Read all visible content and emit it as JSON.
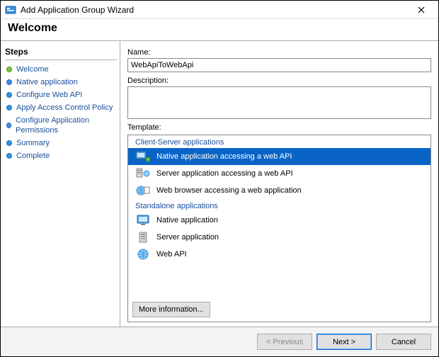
{
  "window": {
    "title": "Add Application Group Wizard"
  },
  "page_header": "Welcome",
  "sidebar": {
    "title": "Steps",
    "items": [
      {
        "label": "Welcome",
        "state": "current"
      },
      {
        "label": "Native application",
        "state": "pending"
      },
      {
        "label": "Configure Web API",
        "state": "pending"
      },
      {
        "label": "Apply Access Control Policy",
        "state": "pending"
      },
      {
        "label": "Configure Application Permissions",
        "state": "pending"
      },
      {
        "label": "Summary",
        "state": "pending"
      },
      {
        "label": "Complete",
        "state": "pending"
      }
    ]
  },
  "main": {
    "name_label": "Name:",
    "name_value": "WebApiToWebApi",
    "description_label": "Description:",
    "description_value": "",
    "template_label": "Template:",
    "groups": {
      "client_server": "Client-Server applications",
      "standalone": "Standalone applications"
    },
    "templates": {
      "native_access_api": "Native application accessing a web API",
      "server_access_api": "Server application accessing a web API",
      "browser_access_app": "Web browser accessing a web application",
      "native_app": "Native application",
      "server_app": "Server application",
      "web_api": "Web API"
    },
    "more_info": "More information..."
  },
  "footer": {
    "previous": "< Previous",
    "next": "Next >",
    "cancel": "Cancel"
  }
}
